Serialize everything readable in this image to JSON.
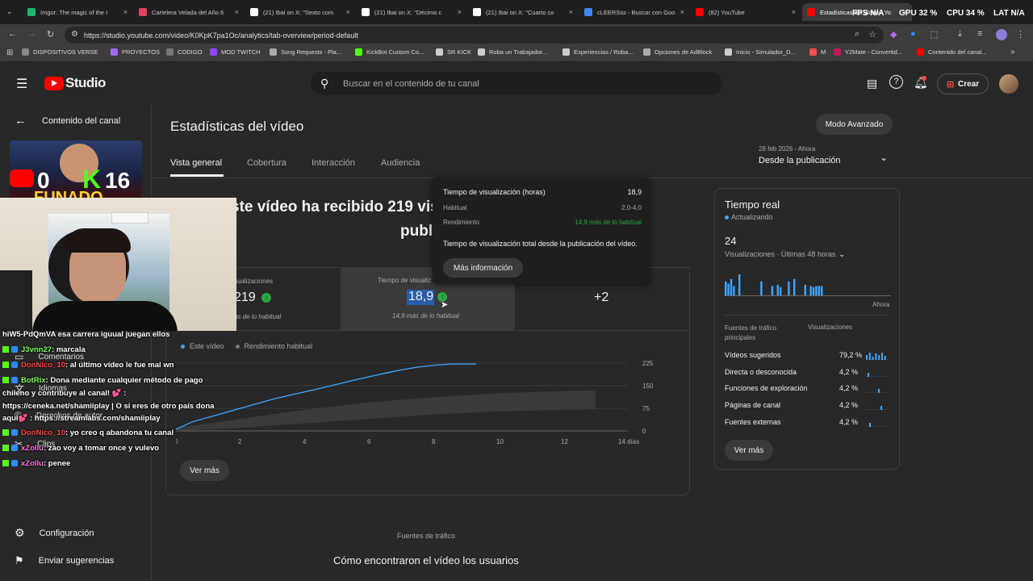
{
  "browser": {
    "tabs": [
      {
        "title": "Imgur: The magic of the I",
        "color": "#1bb76e"
      },
      {
        "title": "Cartelera Velada del Año 6",
        "color": "#e4405f"
      },
      {
        "title": "(21) Ibai on X: \"Sexto com",
        "color": "#ffffff"
      },
      {
        "title": "(21) Ibai on X: \"Décimo c",
        "color": "#ffffff"
      },
      {
        "title": "(21) Ibai on X: \"Cuarto co",
        "color": "#ffffff"
      },
      {
        "title": "cLEERSss - Buscar con Goo",
        "color": "#4285f4"
      },
      {
        "title": "(82) YouTube",
        "color": "#ff0000"
      },
      {
        "title": "Estadísticas del vídeo - Yo",
        "color": "#ff0000"
      }
    ],
    "url": "https://studio.youtube.com/video/K0KpK7pa1Oc/analytics/tab-overview/period-default",
    "bookmarks": [
      "DISPOSITIVOS VERSE",
      "PROYECTOS",
      "CODIGO",
      "MOD TWITCH",
      "Song Requests - Pla...",
      "KickBot Custom Co...",
      "SR KICK",
      "Roba un Trabajador...",
      "Experiencias / Roba...",
      "Opciones de AdBlock",
      "Inicio - Simulador_D...",
      "M",
      "Y2Mate - Convertid...",
      "Contenido del canal..."
    ],
    "hud": {
      "fps_label": "FPS",
      "fps_value": "N/A",
      "gpu_label": "GPU",
      "gpu_value": "32 %",
      "cpu_label": "CPU",
      "cpu_value": "34 %",
      "lat_label": "LAT",
      "lat_value": "N/A"
    }
  },
  "studio": {
    "logo_text": "Studio",
    "search_placeholder": "Buscar en el contenido de tu canal",
    "create_label": "Crear"
  },
  "sidebar": {
    "back_label": "Contenido del canal",
    "thumb_left": "0",
    "thumb_right": "16",
    "thumb_bottom": "FUNADO",
    "items": [
      "Comentarios",
      "Idiomas",
      "Derechos de autor",
      "Clips"
    ],
    "settings_label": "Configuración",
    "feedback_label": "Enviar sugerencias"
  },
  "page": {
    "title": "Estadísticas del vídeo",
    "advanced_button": "Modo Avanzado",
    "tabs": [
      "Vista general",
      "Cobertura",
      "Interacción",
      "Audiencia"
    ],
    "date_range": "28 feb 2026 - Ahora",
    "period": "Desde la publicación",
    "headline": "ste vídeo ha recibido 219 vis",
    "headline_2": "publ",
    "metrics": [
      {
        "label": "sualizaciones",
        "value": "219",
        "sub": "ás de lo habitual"
      },
      {
        "label": "Tiempo de visualiz",
        "value": "18,9",
        "sub": "14,9 más de lo habitual"
      },
      {
        "label": "",
        "value": "+2",
        "sub": ""
      }
    ],
    "legend_this": "Este vídeo",
    "legend_typical": "Rendimiento habitual",
    "see_more": "Ver más",
    "traffic_section_label": "Fuentes de tráfico",
    "traffic_section_title": "Cómo encontraron el vídeo los usuarios"
  },
  "tooltip": {
    "metric_label": "Tiempo de visualización (horas)",
    "metric_value": "18,9",
    "typical_label": "Habitual",
    "typical_value": "2,0-4,0",
    "perf_label": "Rendimiento",
    "perf_value": "14,9 más de lo habitual",
    "description": "Tiempo de visualización total desde la publicación del vídeo.",
    "more_button": "Más información"
  },
  "chart_data": {
    "type": "line",
    "x_ticks": [
      "0",
      "2",
      "4",
      "6",
      "8",
      "10",
      "12",
      "14 días"
    ],
    "y_ticks": [
      "225",
      "150",
      "75",
      "0"
    ],
    "ylim": [
      0,
      225
    ],
    "xlim": [
      0,
      14
    ],
    "series": [
      {
        "name": "Este vídeo",
        "color": "#3ea6ff",
        "x": [
          0,
          0.5,
          1,
          1.5,
          2,
          2.5,
          3,
          3.5,
          4,
          4.5,
          5,
          5.5,
          6,
          6.5,
          7,
          7.5,
          8,
          8.5,
          9.3
        ],
        "y": [
          5,
          30,
          45,
          60,
          75,
          90,
          105,
          118,
          130,
          142,
          155,
          168,
          180,
          192,
          203,
          212,
          218,
          222,
          222
        ]
      }
    ],
    "typical_band": {
      "name": "Rendimiento habitual",
      "x": [
        0,
        2,
        4,
        6,
        8,
        10,
        12,
        13
      ],
      "low": [
        0,
        10,
        25,
        40,
        55,
        65,
        70,
        72
      ],
      "high": [
        10,
        40,
        70,
        95,
        112,
        125,
        132,
        135
      ]
    }
  },
  "realtime": {
    "title": "Tiempo real",
    "status": "Actualizando",
    "count": "24",
    "views_label": "Visualizaciones · Últimas 48 horas",
    "bars": [
      12,
      10,
      14,
      8,
      0,
      18,
      0,
      0,
      0,
      0,
      0,
      0,
      0,
      12,
      0,
      0,
      0,
      8,
      0,
      9,
      7,
      0,
      0,
      12,
      0,
      14,
      0,
      0,
      0,
      9,
      0,
      8,
      7,
      8,
      8,
      8
    ],
    "now_label": "Ahora",
    "sources_header": "Fuentes de tráfico principales",
    "views_header": "Visualizaciones",
    "sources": [
      {
        "name": "Vídeos sugeridos",
        "pct": "79,2 %"
      },
      {
        "name": "Directa o desconocida",
        "pct": "4,2 %"
      },
      {
        "name": "Funciones de exploración",
        "pct": "4,2 %"
      },
      {
        "name": "Páginas de canal",
        "pct": "4,2 %"
      },
      {
        "name": "Fuentes externas",
        "pct": "4,2 %"
      }
    ],
    "see_more": "Ver más"
  },
  "chat": [
    {
      "user": "hiW5-PdQmVA",
      "msg": " esa carrera iguual juegan ellos",
      "color": "#ffffff"
    },
    {
      "user": "J3vnn27",
      "msg": ": marcala",
      "color": "#7cff5a"
    },
    {
      "user": "DonNico_10",
      "msg": ": al último vídeo le fue mal wn",
      "color": "#ff4545"
    },
    {
      "user": "BotRix",
      "msg": ": Dona mediante cualquier método de pago",
      "color": "#7cff5a"
    },
    {
      "user": "",
      "msg": "chileno y contribuye al canal! 💕 :",
      "color": "#ffffff"
    },
    {
      "user": "",
      "msg": "https://ceneka.net/shamiiplay | O si eres de otro país dona",
      "color": "#ffffff"
    },
    {
      "user": "",
      "msg": "aquí💕 : https://streamlabs.com/shamiiplay",
      "color": "#ffffff"
    },
    {
      "user": "DonNico_10",
      "msg": ": yo creo q abandona tu canal",
      "color": "#ff4545"
    },
    {
      "user": "xZollu",
      "msg": ": zao voy a tomar once y vulevo",
      "color": "#ff7ad9"
    },
    {
      "user": "xZollu",
      "msg": ": penee",
      "color": "#ff7ad9"
    }
  ]
}
